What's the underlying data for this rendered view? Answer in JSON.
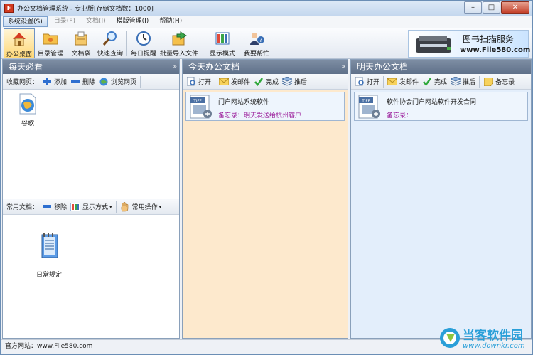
{
  "window": {
    "title": "办公文档管理系统 - 专业版[存储文档数：1000]",
    "app_icon_letter": "F"
  },
  "menu": [
    {
      "label": "系统设置(S)",
      "state": "active"
    },
    {
      "label": "目录(F)",
      "state": "dim"
    },
    {
      "label": "文档(I)",
      "state": "dim"
    },
    {
      "label": "模版管理(I)",
      "state": "normal"
    },
    {
      "label": "帮助(H)",
      "state": "normal"
    }
  ],
  "toolbar": {
    "items": [
      {
        "label": "办公桌面",
        "icon": "house-icon"
      },
      {
        "label": "目录管理",
        "icon": "folder-icon"
      },
      {
        "label": "文档袋",
        "icon": "document-bag-icon"
      },
      {
        "label": "快速查询",
        "icon": "magnifier-icon"
      },
      {
        "label": "每日提醒",
        "icon": "clock-icon"
      },
      {
        "label": "批量导入文件",
        "icon": "import-icon"
      },
      {
        "label": "显示模式",
        "icon": "layout-icon"
      },
      {
        "label": "我要帮忙",
        "icon": "help-icon"
      }
    ]
  },
  "ad": {
    "title": "图书扫描服务",
    "url": "www.File580.com"
  },
  "left_panel": {
    "header": "每天必看",
    "favorites_label": "收藏网页：",
    "favorites_actions": {
      "add": "添加",
      "delete": "删除",
      "browse": "浏览网页"
    },
    "favorites": [
      {
        "label": "谷歌",
        "icon": "globe-icon"
      }
    ],
    "docs_label": "常用文档：",
    "docs_actions": {
      "remove": "移除",
      "view_mode": "显示方式",
      "common_ops": "常用操作"
    },
    "docs": [
      {
        "label": "日常规定",
        "icon": "notepad-icon"
      }
    ]
  },
  "today_panel": {
    "header": "今天办公文档",
    "actions": {
      "open": "打开",
      "email": "发邮件",
      "done": "完成",
      "postpone": "推后"
    },
    "doc": {
      "name": "门户网站系统软件",
      "memo": "备忘录：明天发送给杭州客户",
      "icon_tag": "TIFF"
    }
  },
  "tomorrow_panel": {
    "header": "明天办公文档",
    "actions": {
      "open": "打开",
      "email": "发邮件",
      "done": "完成",
      "postpone": "推后",
      "memo": "备忘录"
    },
    "doc": {
      "name": "软件协会门户网站软件开发合同",
      "memo": "备忘录：",
      "icon_tag": "TIFF"
    }
  },
  "status": {
    "text": "官方网站：www.File580.com"
  },
  "watermark": {
    "name": "当客软件园",
    "url": "www.downkr.com"
  },
  "colors": {
    "today_bg": "#fde9cd",
    "tomorrow_bg": "#e3eefb",
    "panel_header": "#6c7d96",
    "memo_text": "#9b1d9b"
  }
}
